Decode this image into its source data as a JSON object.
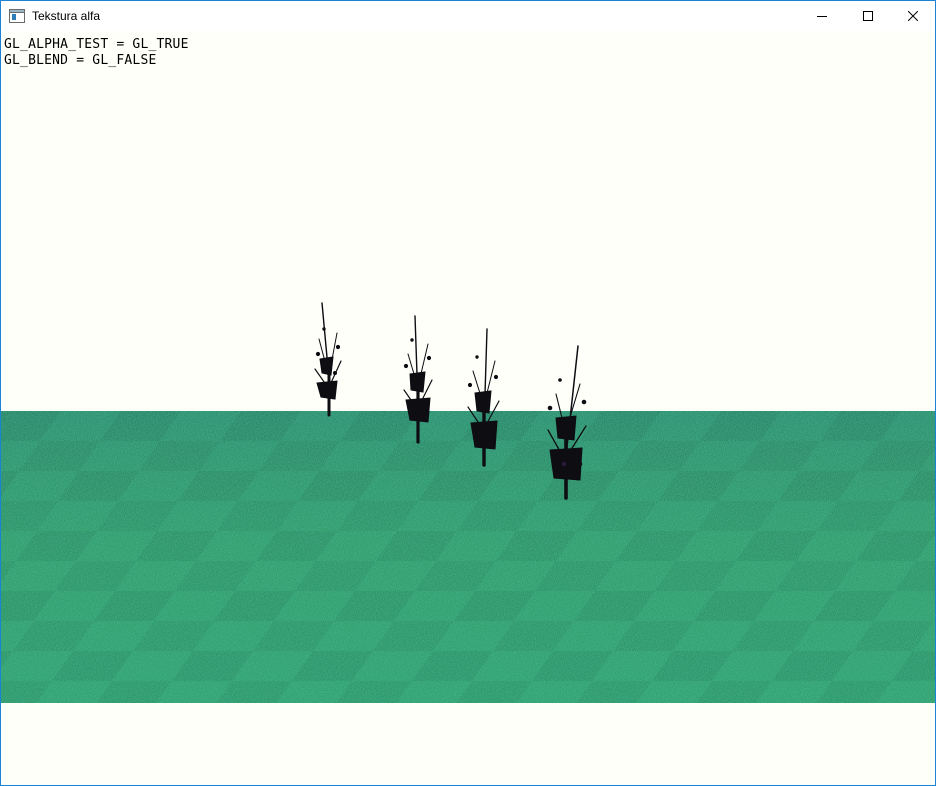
{
  "window": {
    "title": "Tekstura alfa",
    "controls": {
      "minimize": "minimize",
      "maximize": "maximize",
      "close": "close"
    }
  },
  "scene": {
    "hud": [
      "GL_ALPHA_TEST = GL_TRUE",
      "GL_BLEND = GL_FALSE"
    ],
    "colors": {
      "background": "#fffffa",
      "grass_dark": "#1f7a5c",
      "grass_light": "#3aa86a",
      "tree": "#0d0d12"
    },
    "trees": 4
  }
}
